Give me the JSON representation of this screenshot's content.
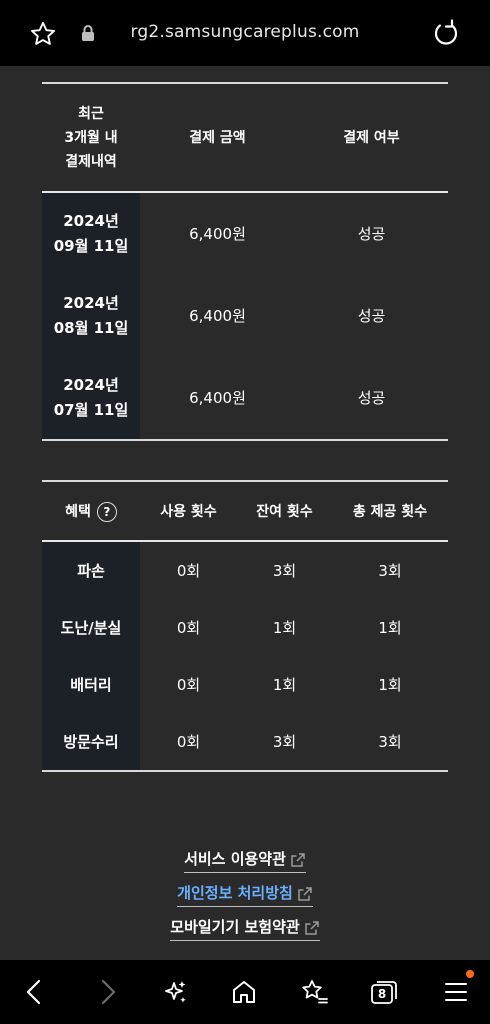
{
  "browser": {
    "url": "rg2.samsungcareplus.com",
    "tab_count": "8"
  },
  "payments": {
    "headers": [
      "최근\n3개월 내\n결제내역",
      "결제 금액",
      "결제 여부"
    ],
    "rows": [
      {
        "date": "2024년\n09월 11일",
        "amount": "6,400원",
        "status": "성공"
      },
      {
        "date": "2024년\n08월 11일",
        "amount": "6,400원",
        "status": "성공"
      },
      {
        "date": "2024년\n07월 11일",
        "amount": "6,400원",
        "status": "성공"
      }
    ]
  },
  "benefits": {
    "header_label": "혜택",
    "help_symbol": "?",
    "headers": [
      "사용 횟수",
      "잔여 횟수",
      "총 제공 횟수"
    ],
    "rows": [
      {
        "name": "파손",
        "used": "0회",
        "remaining": "3회",
        "total": "3회"
      },
      {
        "name": "도난/분실",
        "used": "0회",
        "remaining": "1회",
        "total": "1회"
      },
      {
        "name": "배터리",
        "used": "0회",
        "remaining": "1회",
        "total": "1회"
      },
      {
        "name": "방문수리",
        "used": "0회",
        "remaining": "3회",
        "total": "3회"
      }
    ]
  },
  "footer_links": [
    {
      "label": "서비스 이용약관"
    },
    {
      "label": "개인정보 처리방침"
    },
    {
      "label": "모바일기기 보험약관"
    }
  ],
  "colors": {
    "accent_link": "#6ab0ff",
    "notification_dot": "#ff6a1a"
  }
}
